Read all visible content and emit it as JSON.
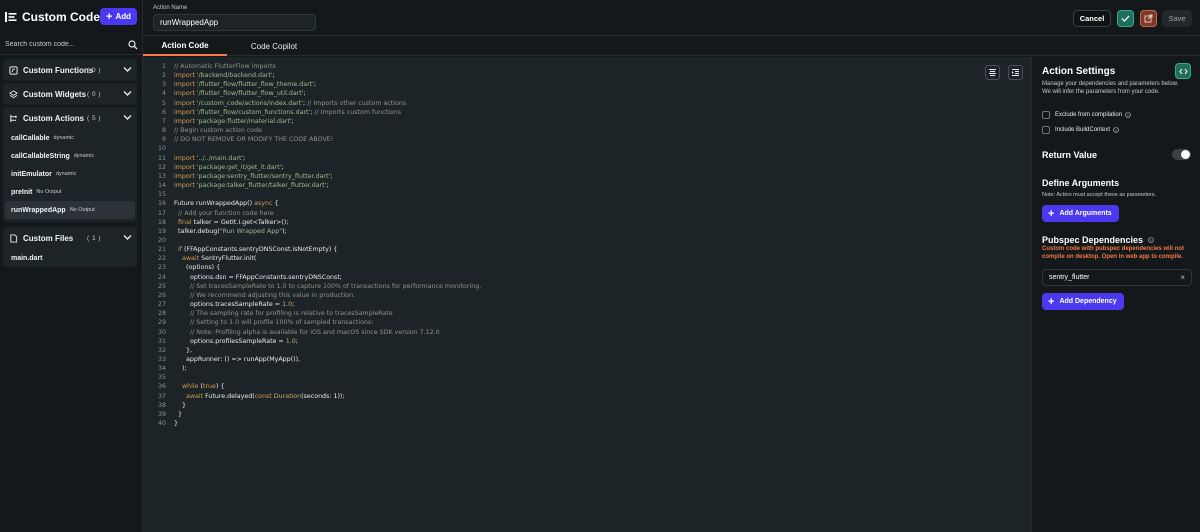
{
  "sidebar": {
    "title": "Custom Code",
    "add_label": "Add",
    "search_placeholder": "Search custom code...",
    "groups": [
      {
        "name": "Custom Functions",
        "count": "( 0 )",
        "icon": "function-icon",
        "items": []
      },
      {
        "name": "Custom Widgets",
        "count": "( 0 )",
        "icon": "widget-icon",
        "items": []
      },
      {
        "name": "Custom Actions",
        "count": "( 5 )",
        "icon": "action-icon",
        "items": [
          {
            "name": "callCallable",
            "tag": "dynamic"
          },
          {
            "name": "callCallableString",
            "tag": "dynamic"
          },
          {
            "name": "initEmulator",
            "tag": "dynamic"
          },
          {
            "name": "preInit",
            "tag": "No Output"
          },
          {
            "name": "runWrappedApp",
            "tag": "No Output",
            "selected": true
          }
        ]
      },
      {
        "name": "Custom Files",
        "count": "( 1 )",
        "icon": "file-icon",
        "items": [
          {
            "name": "main.dart",
            "tag": ""
          }
        ]
      }
    ]
  },
  "topbar": {
    "action_name_label": "Action Name",
    "action_name_value": "runWrappedApp",
    "cancel_label": "Cancel",
    "save_label": "Save"
  },
  "tabs": [
    {
      "label": "Action Code",
      "active": true
    },
    {
      "label": "Code Copilot",
      "active": false
    }
  ],
  "code_lines": [
    [
      [
        "c",
        "// Automatic FlutterFlow imports"
      ]
    ],
    [
      [
        "k",
        "import "
      ],
      [
        "s",
        "'/backend/backend.dart'"
      ],
      [
        "t",
        ";"
      ]
    ],
    [
      [
        "k",
        "import "
      ],
      [
        "s",
        "'/flutter_flow/flutter_flow_theme.dart'"
      ],
      [
        "t",
        ";"
      ]
    ],
    [
      [
        "k",
        "import "
      ],
      [
        "s",
        "'/flutter_flow/flutter_flow_util.dart'"
      ],
      [
        "t",
        ";"
      ]
    ],
    [
      [
        "k",
        "import "
      ],
      [
        "s",
        "'/custom_code/actions/index.dart'"
      ],
      [
        "t",
        "; "
      ],
      [
        "c",
        "// Imports other custom actions"
      ]
    ],
    [
      [
        "k",
        "import "
      ],
      [
        "s",
        "'/flutter_flow/custom_functions.dart'"
      ],
      [
        "t",
        "; "
      ],
      [
        "c",
        "// Imports custom functions"
      ]
    ],
    [
      [
        "k",
        "import "
      ],
      [
        "s",
        "'package:flutter/material.dart'"
      ],
      [
        "t",
        ";"
      ]
    ],
    [
      [
        "c",
        "// Begin custom action code"
      ]
    ],
    [
      [
        "c",
        "// DO NOT REMOVE OR MODIFY THE CODE ABOVE!"
      ]
    ],
    [],
    [
      [
        "k",
        "import "
      ],
      [
        "s",
        "'../../main.dart'"
      ],
      [
        "t",
        ";"
      ]
    ],
    [
      [
        "k",
        "import "
      ],
      [
        "s",
        "'package:get_it/get_it.dart'"
      ],
      [
        "t",
        ";"
      ]
    ],
    [
      [
        "k",
        "import "
      ],
      [
        "s",
        "'package:sentry_flutter/sentry_flutter.dart'"
      ],
      [
        "t",
        ";"
      ]
    ],
    [
      [
        "k",
        "import "
      ],
      [
        "s",
        "'package:talker_flutter/talker_flutter.dart'"
      ],
      [
        "t",
        ";"
      ]
    ],
    [],
    [
      [
        "t",
        "Future runWrappedApp() "
      ],
      [
        "k",
        "async"
      ],
      [
        "t",
        " {"
      ]
    ],
    [
      [
        "c",
        "  // Add your function code here"
      ]
    ],
    [
      [
        "t",
        "  "
      ],
      [
        "k",
        "final"
      ],
      [
        "t",
        " talker = GetIt.I.get<Talker>();"
      ]
    ],
    [
      [
        "t",
        "  talker.debug("
      ],
      [
        "s",
        "\"Run Wrapped App\""
      ],
      [
        "t",
        ");"
      ]
    ],
    [],
    [
      [
        "t",
        "  "
      ],
      [
        "k",
        "if"
      ],
      [
        "t",
        " (FFAppConstants.sentryDNSConst.isNotEmpty) {"
      ]
    ],
    [
      [
        "t",
        "    "
      ],
      [
        "k",
        "await"
      ],
      [
        "t",
        " SentryFlutter.init("
      ]
    ],
    [
      [
        "t",
        "      (options) {"
      ]
    ],
    [
      [
        "t",
        "        options.dsn = FFAppConstants.sentryDNSConst;"
      ]
    ],
    [
      [
        "c",
        "        // Set tracesSampleRate to 1.0 to capture 100% of transactions for performance monitoring."
      ]
    ],
    [
      [
        "c",
        "        // We recommend adjusting this value in production."
      ]
    ],
    [
      [
        "t",
        "        options.tracesSampleRate = "
      ],
      [
        "n",
        "1.0"
      ],
      [
        "t",
        ";"
      ]
    ],
    [
      [
        "c",
        "        // The sampling rate for profiling is relative to tracesSampleRate"
      ]
    ],
    [
      [
        "c",
        "        // Setting to 1.0 will profile 100% of sampled transactions:"
      ]
    ],
    [
      [
        "c",
        "        // Note: Profiling alpha is available for iOS and macOS since SDK version 7.12.0"
      ]
    ],
    [
      [
        "t",
        "        options.profilesSampleRate = "
      ],
      [
        "n",
        "1.0"
      ],
      [
        "t",
        ";"
      ]
    ],
    [
      [
        "t",
        "      },"
      ]
    ],
    [
      [
        "t",
        "      appRunner: () => runApp(MyApp()),"
      ]
    ],
    [
      [
        "t",
        "    );"
      ]
    ],
    [],
    [
      [
        "t",
        "    "
      ],
      [
        "k",
        "while"
      ],
      [
        "t",
        " ("
      ],
      [
        "k",
        "true"
      ],
      [
        "t",
        ") {"
      ]
    ],
    [
      [
        "t",
        "      "
      ],
      [
        "k",
        "await"
      ],
      [
        "t",
        " Future.delayed("
      ],
      [
        "k",
        "const"
      ],
      [
        "t",
        " "
      ],
      [
        "n",
        "Duration"
      ],
      [
        "t",
        "(seconds: 1));"
      ]
    ],
    [
      [
        "t",
        "    }"
      ]
    ],
    [
      [
        "t",
        "  }"
      ]
    ],
    [
      [
        "t",
        "}"
      ]
    ]
  ],
  "panel": {
    "title": "Action Settings",
    "description": "Manage your dependencies and parameters below.\nWe will infer the parameters from your code.",
    "exclude_label": "Exclude from compilation",
    "include_label": "Include BuildContext",
    "return_value_label": "Return Value",
    "define_args_label": "Define Arguments",
    "define_args_note": "Note: Action must accept these as parameters.",
    "add_args_label": "Add Arguments",
    "pubspec_label": "Pubspec Dependencies",
    "pubspec_warning": "Custom code with pubspec dependencies will not compile on desktop. Open in web app to compile.",
    "dependency_value": "sentry_flutter",
    "add_dep_label": "Add Dependency"
  },
  "colors": {
    "accent": "#4b39ef",
    "success": "#1f6e5b",
    "warning": "#ef7a45"
  }
}
